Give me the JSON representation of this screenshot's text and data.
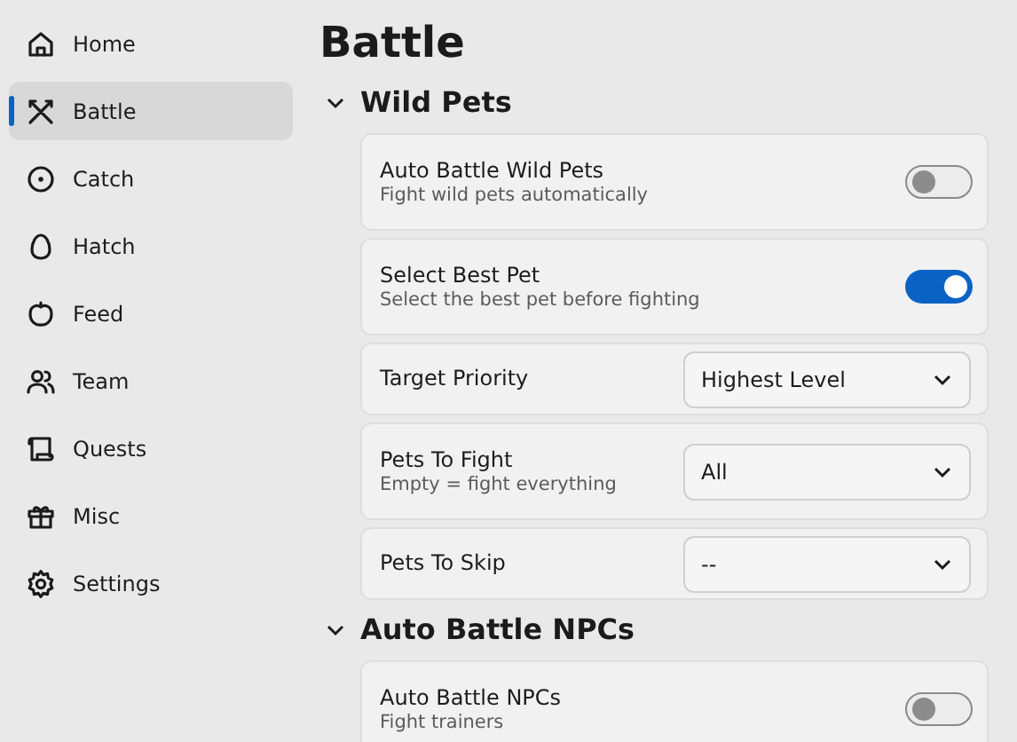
{
  "sidebar": {
    "items": [
      {
        "label": "Home",
        "selected": false
      },
      {
        "label": "Battle",
        "selected": true
      },
      {
        "label": "Catch",
        "selected": false
      },
      {
        "label": "Hatch",
        "selected": false
      },
      {
        "label": "Feed",
        "selected": false
      },
      {
        "label": "Team",
        "selected": false
      },
      {
        "label": "Quests",
        "selected": false
      },
      {
        "label": "Misc",
        "selected": false
      },
      {
        "label": "Settings",
        "selected": false
      }
    ]
  },
  "page_title": "Battle",
  "sections": [
    {
      "title": "Wild Pets",
      "expanded": true,
      "settings": [
        {
          "kind": "toggle",
          "label": "Auto Battle Wild Pets",
          "description": "Fight wild pets automatically",
          "on": false
        },
        {
          "kind": "toggle",
          "label": "Select Best Pet",
          "description": "Select the best pet before fighting",
          "on": true
        },
        {
          "kind": "select",
          "label": "Target Priority",
          "value": "Highest Level"
        },
        {
          "kind": "select",
          "label": "Pets To Fight",
          "description": "Empty = fight everything",
          "value": "All"
        },
        {
          "kind": "select",
          "label": "Pets To Skip",
          "value": "--"
        }
      ]
    },
    {
      "title": "Auto Battle NPCs",
      "expanded": true,
      "settings": [
        {
          "kind": "toggle",
          "label": "Auto Battle NPCs",
          "description": "Fight trainers",
          "on": false
        }
      ]
    }
  ]
}
